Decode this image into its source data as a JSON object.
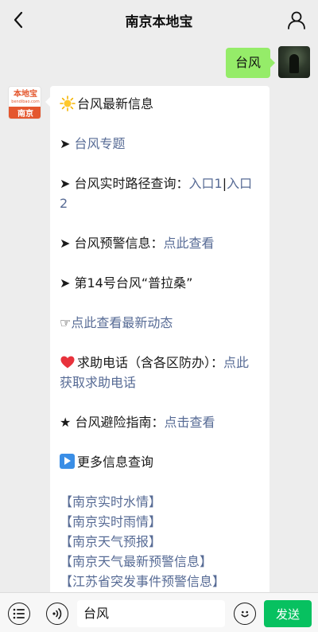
{
  "header": {
    "title": "南京本地宝",
    "back_icon": "chevron-left-icon",
    "profile_icon": "person-icon"
  },
  "outgoing": {
    "text": "台风"
  },
  "bot": {
    "logo_main": "本地宝",
    "logo_sub": "bendibao.com",
    "logo_city": "南京"
  },
  "message": {
    "item_latest": "台风最新信息",
    "arrow": "➤",
    "item_topic_link": "台风专题",
    "item_route_label": "台风实时路径查询：",
    "item_route_link1": "入口1",
    "item_route_sep": "|",
    "item_route_link2": "入口2",
    "item_warning_label": "台风预警信息：",
    "item_warning_link": "点此查看",
    "item_typhoon14": "第14号台风“普拉桑”",
    "pointer": "☞",
    "item_news_link": "点此查看最新动态",
    "item_help_label": "求助电话（含各区防办）：",
    "item_help_link": "点此获取求助电话",
    "star": "★",
    "item_guide_label": "台风避险指南：",
    "item_guide_link": "点击查看",
    "item_more": "更多信息查询",
    "more_links": [
      "【南京实时水情】",
      "【南京实时雨情】",
      "【南京天气预报】",
      "【南京天气最新预警信息】",
      "【江苏省突发事件预警信息】"
    ]
  },
  "input_bar": {
    "menu_icon": "list-menu-icon",
    "voice_icon": "voice-icon",
    "input_value": "台风",
    "emoji_icon": "emoji-icon",
    "send_label": "发送"
  },
  "colors": {
    "background": "#ededed",
    "outgoing_bubble": "#95ec69",
    "link": "#576b95",
    "send_button": "#07c160",
    "brand_orange": "#e4572e"
  }
}
